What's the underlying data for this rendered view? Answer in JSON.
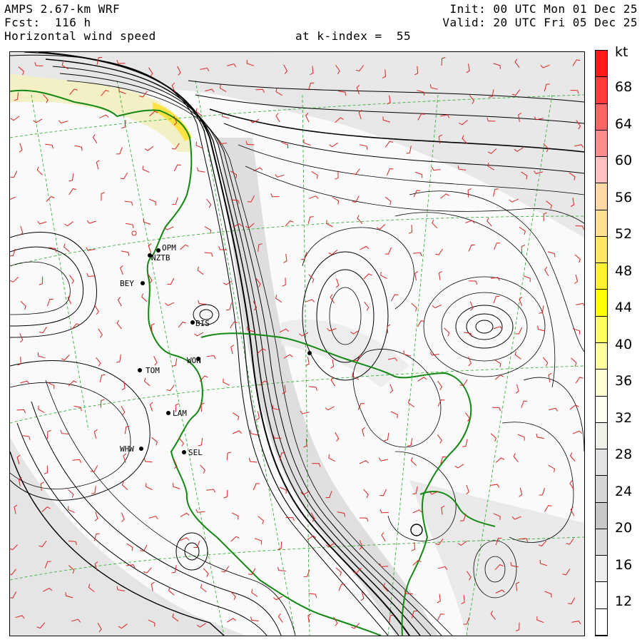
{
  "header": {
    "model": "AMPS 2.67-km WRF",
    "forecast": "Fcst:  116 h",
    "field": "Horizontal wind speed",
    "level": "at k-index =  55",
    "init": "Init: 00 UTC Mon 01 Dec 25",
    "valid": "Valid: 20 UTC Fri 05 Dec 25"
  },
  "colorbar": {
    "unit": "kt",
    "labels": [
      "68",
      "64",
      "60",
      "56",
      "52",
      "48",
      "44",
      "40",
      "36",
      "32",
      "28",
      "24",
      "20",
      "16",
      "12"
    ],
    "colors": [
      "#ff1a1a",
      "#ff3c3c",
      "#ff6464",
      "#ff8c8c",
      "#ffc0c0",
      "#ffd8a8",
      "#ffe090",
      "#ffe860",
      "#fff030",
      "#ffff00",
      "#ffff60",
      "#ffffa0",
      "#ffffd0",
      "#fffff0",
      "#f0f0e8",
      "#e4e4e4",
      "#d6d6d6",
      "#c8c8c8",
      "#dcdcdc",
      "#eeeeee",
      "#fafafa",
      "#ffffff"
    ]
  },
  "stations": [
    {
      "name": "OPM"
    },
    {
      "name": "NZTB"
    },
    {
      "name": "BEY"
    },
    {
      "name": "BIS"
    },
    {
      "name": "WON"
    },
    {
      "name": "TOM"
    },
    {
      "name": "LAM"
    },
    {
      "name": "WHW"
    },
    {
      "name": "SEL"
    },
    {
      "name": ""
    }
  ],
  "colors": {
    "coastline": "#118811",
    "barbs": "#dd2222",
    "gridlines": "#22aa22",
    "streamlines": "#000000",
    "highlight": "#ffe020"
  }
}
